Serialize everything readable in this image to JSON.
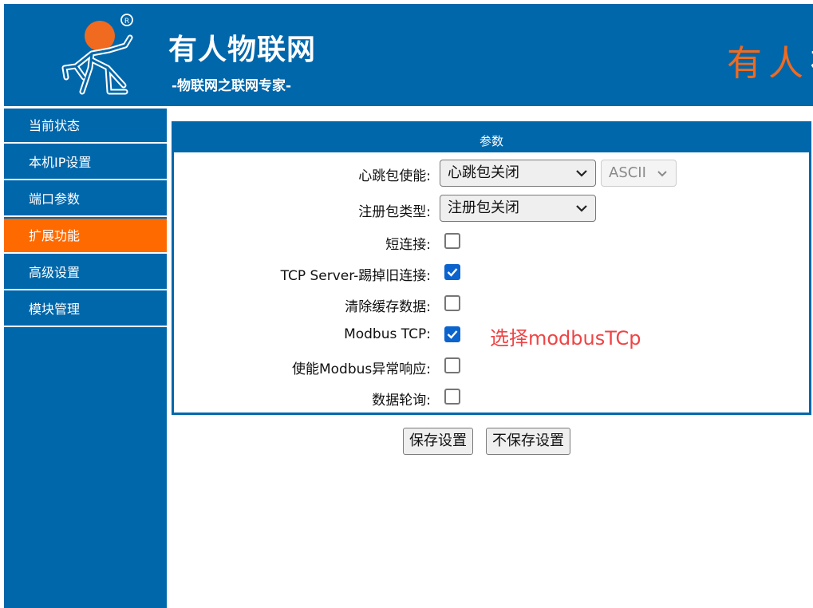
{
  "header": {
    "brand_title": "有人物联网",
    "brand_slogan": "-物联网之联网专家-",
    "brand_script": "有人",
    "brand_script_tail": "在",
    "logo_icon": "running-man-logo-icon",
    "colors": {
      "primary": "#0067ab",
      "accent": "#ff6a00",
      "script": "#f06a1f"
    }
  },
  "sidebar": {
    "items": [
      {
        "label": "当前状态",
        "active": false
      },
      {
        "label": "本机IP设置",
        "active": false
      },
      {
        "label": "端口参数",
        "active": false
      },
      {
        "label": "扩展功能",
        "active": true
      },
      {
        "label": "高级设置",
        "active": false
      },
      {
        "label": "模块管理",
        "active": false
      }
    ]
  },
  "panel": {
    "title": "参数",
    "heartbeat": {
      "label": "心跳包使能:",
      "value": "心跳包关闭",
      "format_value": "ASCII"
    },
    "register": {
      "label": "注册包类型:",
      "value": "注册包关闭"
    },
    "checkboxes": [
      {
        "label": "短连接:",
        "checked": false
      },
      {
        "label": "TCP Server-踢掉旧连接:",
        "checked": true
      },
      {
        "label": "清除缓存数据:",
        "checked": false
      },
      {
        "label": "Modbus TCP:",
        "checked": true
      },
      {
        "label": "使能Modbus异常响应:",
        "checked": false
      },
      {
        "label": "数据轮询:",
        "checked": false
      }
    ],
    "annotation": "选择modbusTCp",
    "annotation_color": "#ef4444"
  },
  "buttons": {
    "save": "保存设置",
    "discard": "不保存设置"
  }
}
